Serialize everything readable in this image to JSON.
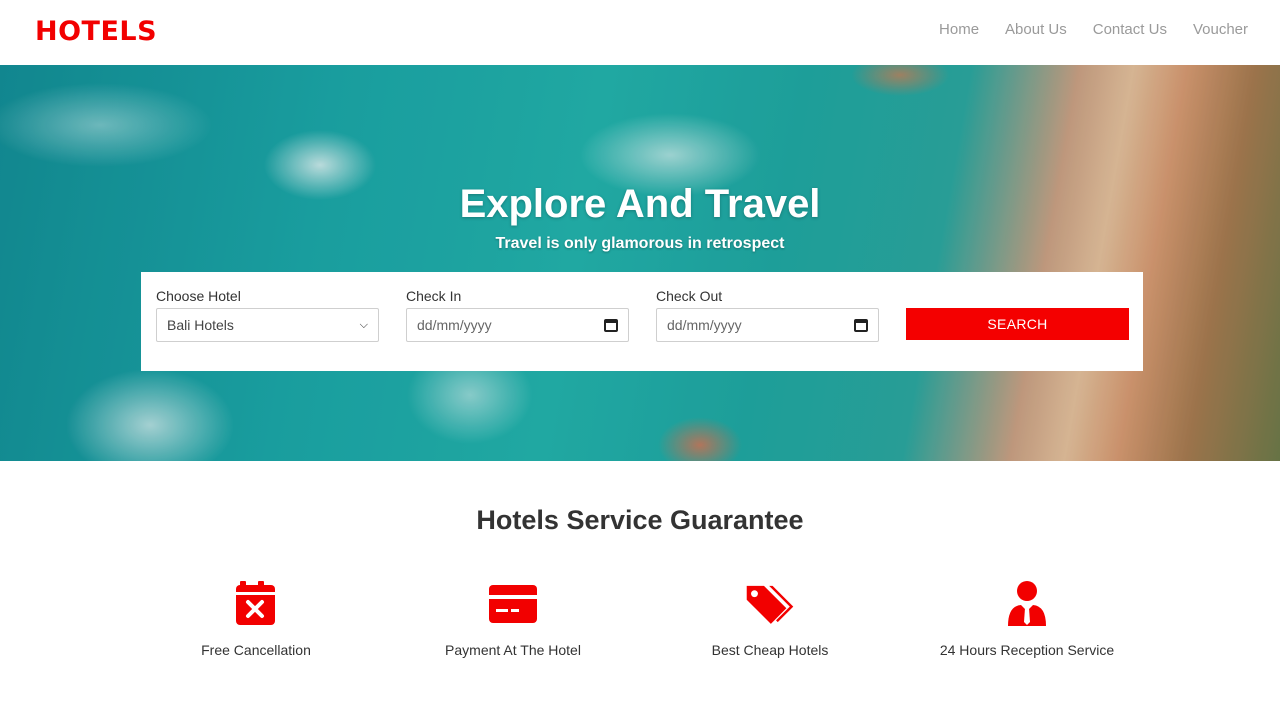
{
  "header": {
    "logo": "HOTELS",
    "nav": [
      "Home",
      "About Us",
      "Contact Us",
      "Voucher"
    ]
  },
  "hero": {
    "title": "Explore And Travel",
    "subtitle": "Travel is only glamorous in retrospect"
  },
  "search": {
    "hotel_label": "Choose Hotel",
    "hotel_value": "Bali Hotels",
    "checkin_label": "Check In",
    "checkin_placeholder": "dd/mm/yyyy",
    "checkout_label": "Check Out",
    "checkout_placeholder": "dd/mm/yyyy",
    "button_label": "SEARCH"
  },
  "services": {
    "title": "Hotels Service Guarantee",
    "items": [
      {
        "label": "Free Cancellation",
        "icon": "calendar-cancel-icon"
      },
      {
        "label": "Payment At The Hotel",
        "icon": "credit-card-icon"
      },
      {
        "label": "Best Cheap Hotels",
        "icon": "price-tags-icon"
      },
      {
        "label": "24 Hours Reception Service",
        "icon": "receptionist-icon"
      }
    ]
  },
  "colors": {
    "brand": "#f20000",
    "button": "#f40000",
    "nav_text": "#9a9a9a"
  }
}
